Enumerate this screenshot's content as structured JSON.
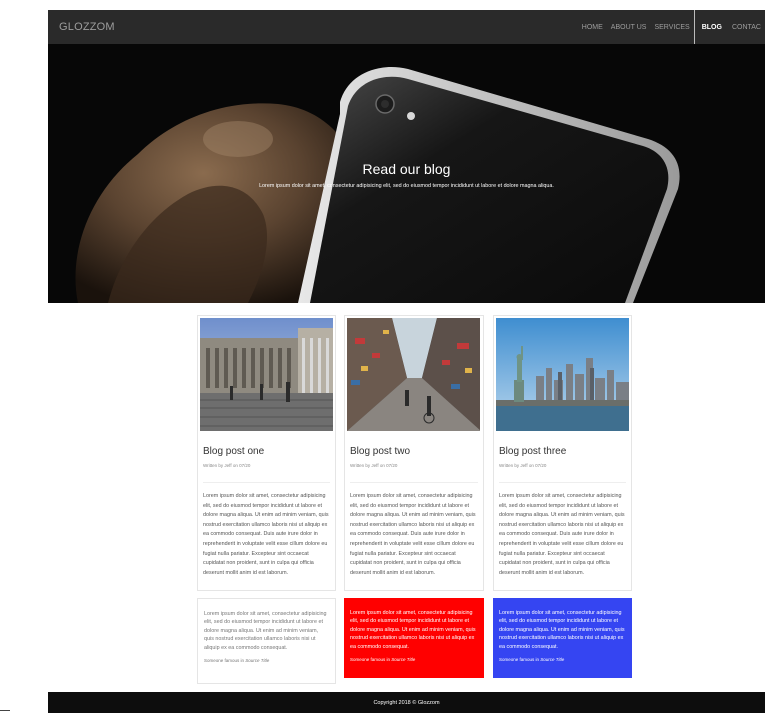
{
  "navbar": {
    "brand": "GLOZZOM",
    "items": [
      {
        "label": "HOME",
        "active": false
      },
      {
        "label": "ABOUT US",
        "active": false
      },
      {
        "label": "SERVICES",
        "active": false
      },
      {
        "label": "BLOG",
        "active": true
      },
      {
        "label": "CONTAC",
        "active": false
      }
    ]
  },
  "hero": {
    "title": "Read our blog",
    "subtitle": "Lorem ipsum dolor sit amet, consectetur adipisicing elit, sed do eiusmod tempor incididunt ut labore et dolore magna aliqua."
  },
  "posts": [
    {
      "title": "Blog post one",
      "meta": "Written by Jeff on 07/20",
      "image": "building-courtyard-photo",
      "body": "Lorem ipsum dolor sit amet, consectetur adipisicing elit, sed do eiusmod tempor incididunt ut labore et dolore magna aliqua. Ut enim ad minim veniam, quis nostrud exercitation ullamco laboris nisi ut aliquip ex ea commodo consequat. Duis aute irure dolor in reprehenderit in voluptate velit esse cillum dolore eu fugiat nulla pariatur. Excepteur sint occaecat cupidatat non proident, sunt in culpa qui officia deserunt mollit anim id est laborum."
    },
    {
      "title": "Blog post two",
      "meta": "Written by Jeff on 07/20",
      "image": "city-street-photo",
      "body": "Lorem ipsum dolor sit amet, consectetur adipisicing elit, sed do eiusmod tempor incididunt ut labore et dolore magna aliqua. Ut enim ad minim veniam, quis nostrud exercitation ullamco laboris nisi ut aliquip ex ea commodo consequat. Duis aute irure dolor in reprehenderit in voluptate velit esse cillum dolore eu fugiat nulla pariatur. Excepteur sint occaecat cupidatat non proident, sunt in culpa qui officia deserunt mollit anim id est laborum."
    },
    {
      "title": "Blog post three",
      "meta": "Written by Jeff on 07/20",
      "image": "statue-of-liberty-skyline-photo",
      "body": "Lorem ipsum dolor sit amet, consectetur adipisicing elit, sed do eiusmod tempor incididunt ut labore et dolore magna aliqua. Ut enim ad minim veniam, quis nostrud exercitation ullamco laboris nisi ut aliquip ex ea commodo consequat. Duis aute irure dolor in reprehenderit in voluptate velit esse cillum dolore eu fugiat nulla pariatur. Excepteur sint occaecat cupidatat non proident, sunt in culpa qui officia deserunt mollit anim id est laborum."
    }
  ],
  "quotes": [
    {
      "text": "Lorem ipsum dolor sit amet, consectetur adipisicing elit, sed do eiusmod tempor incididunt ut labore et dolore magna aliqua. Ut enim ad minim veniam, quis nostrud exercitation ullamco laboris nisi ut aliquip ex ea commodo consequat.",
      "footer": "Someone famous in",
      "source": "Source Title",
      "color": "#ffffff"
    },
    {
      "text": "Lorem ipsum dolor sit amet, consectetur adipisicing elit, sed do eiusmod tempor incididunt ut labore et dolore magna aliqua. Ut enim ad minim veniam, quis nostrud exercitation ullamco laboris nisi ut aliquip ex ea commodo consequat.",
      "footer": "Someone famous in",
      "source": "Source Title",
      "color": "#ff0000"
    },
    {
      "text": "Lorem ipsum dolor sit amet, consectetur adipisicing elit, sed do eiusmod tempor incididunt ut labore et dolore magna aliqua. Ut enim ad minim veniam, quis nostrud exercitation ullamco laboris nisi ut aliquip ex ea commodo consequat.",
      "footer": "Someone famous in",
      "source": "Source Title",
      "color": "#3545f2"
    }
  ],
  "footer": {
    "copyright": "Copyright 2018 © Glozzom"
  }
}
